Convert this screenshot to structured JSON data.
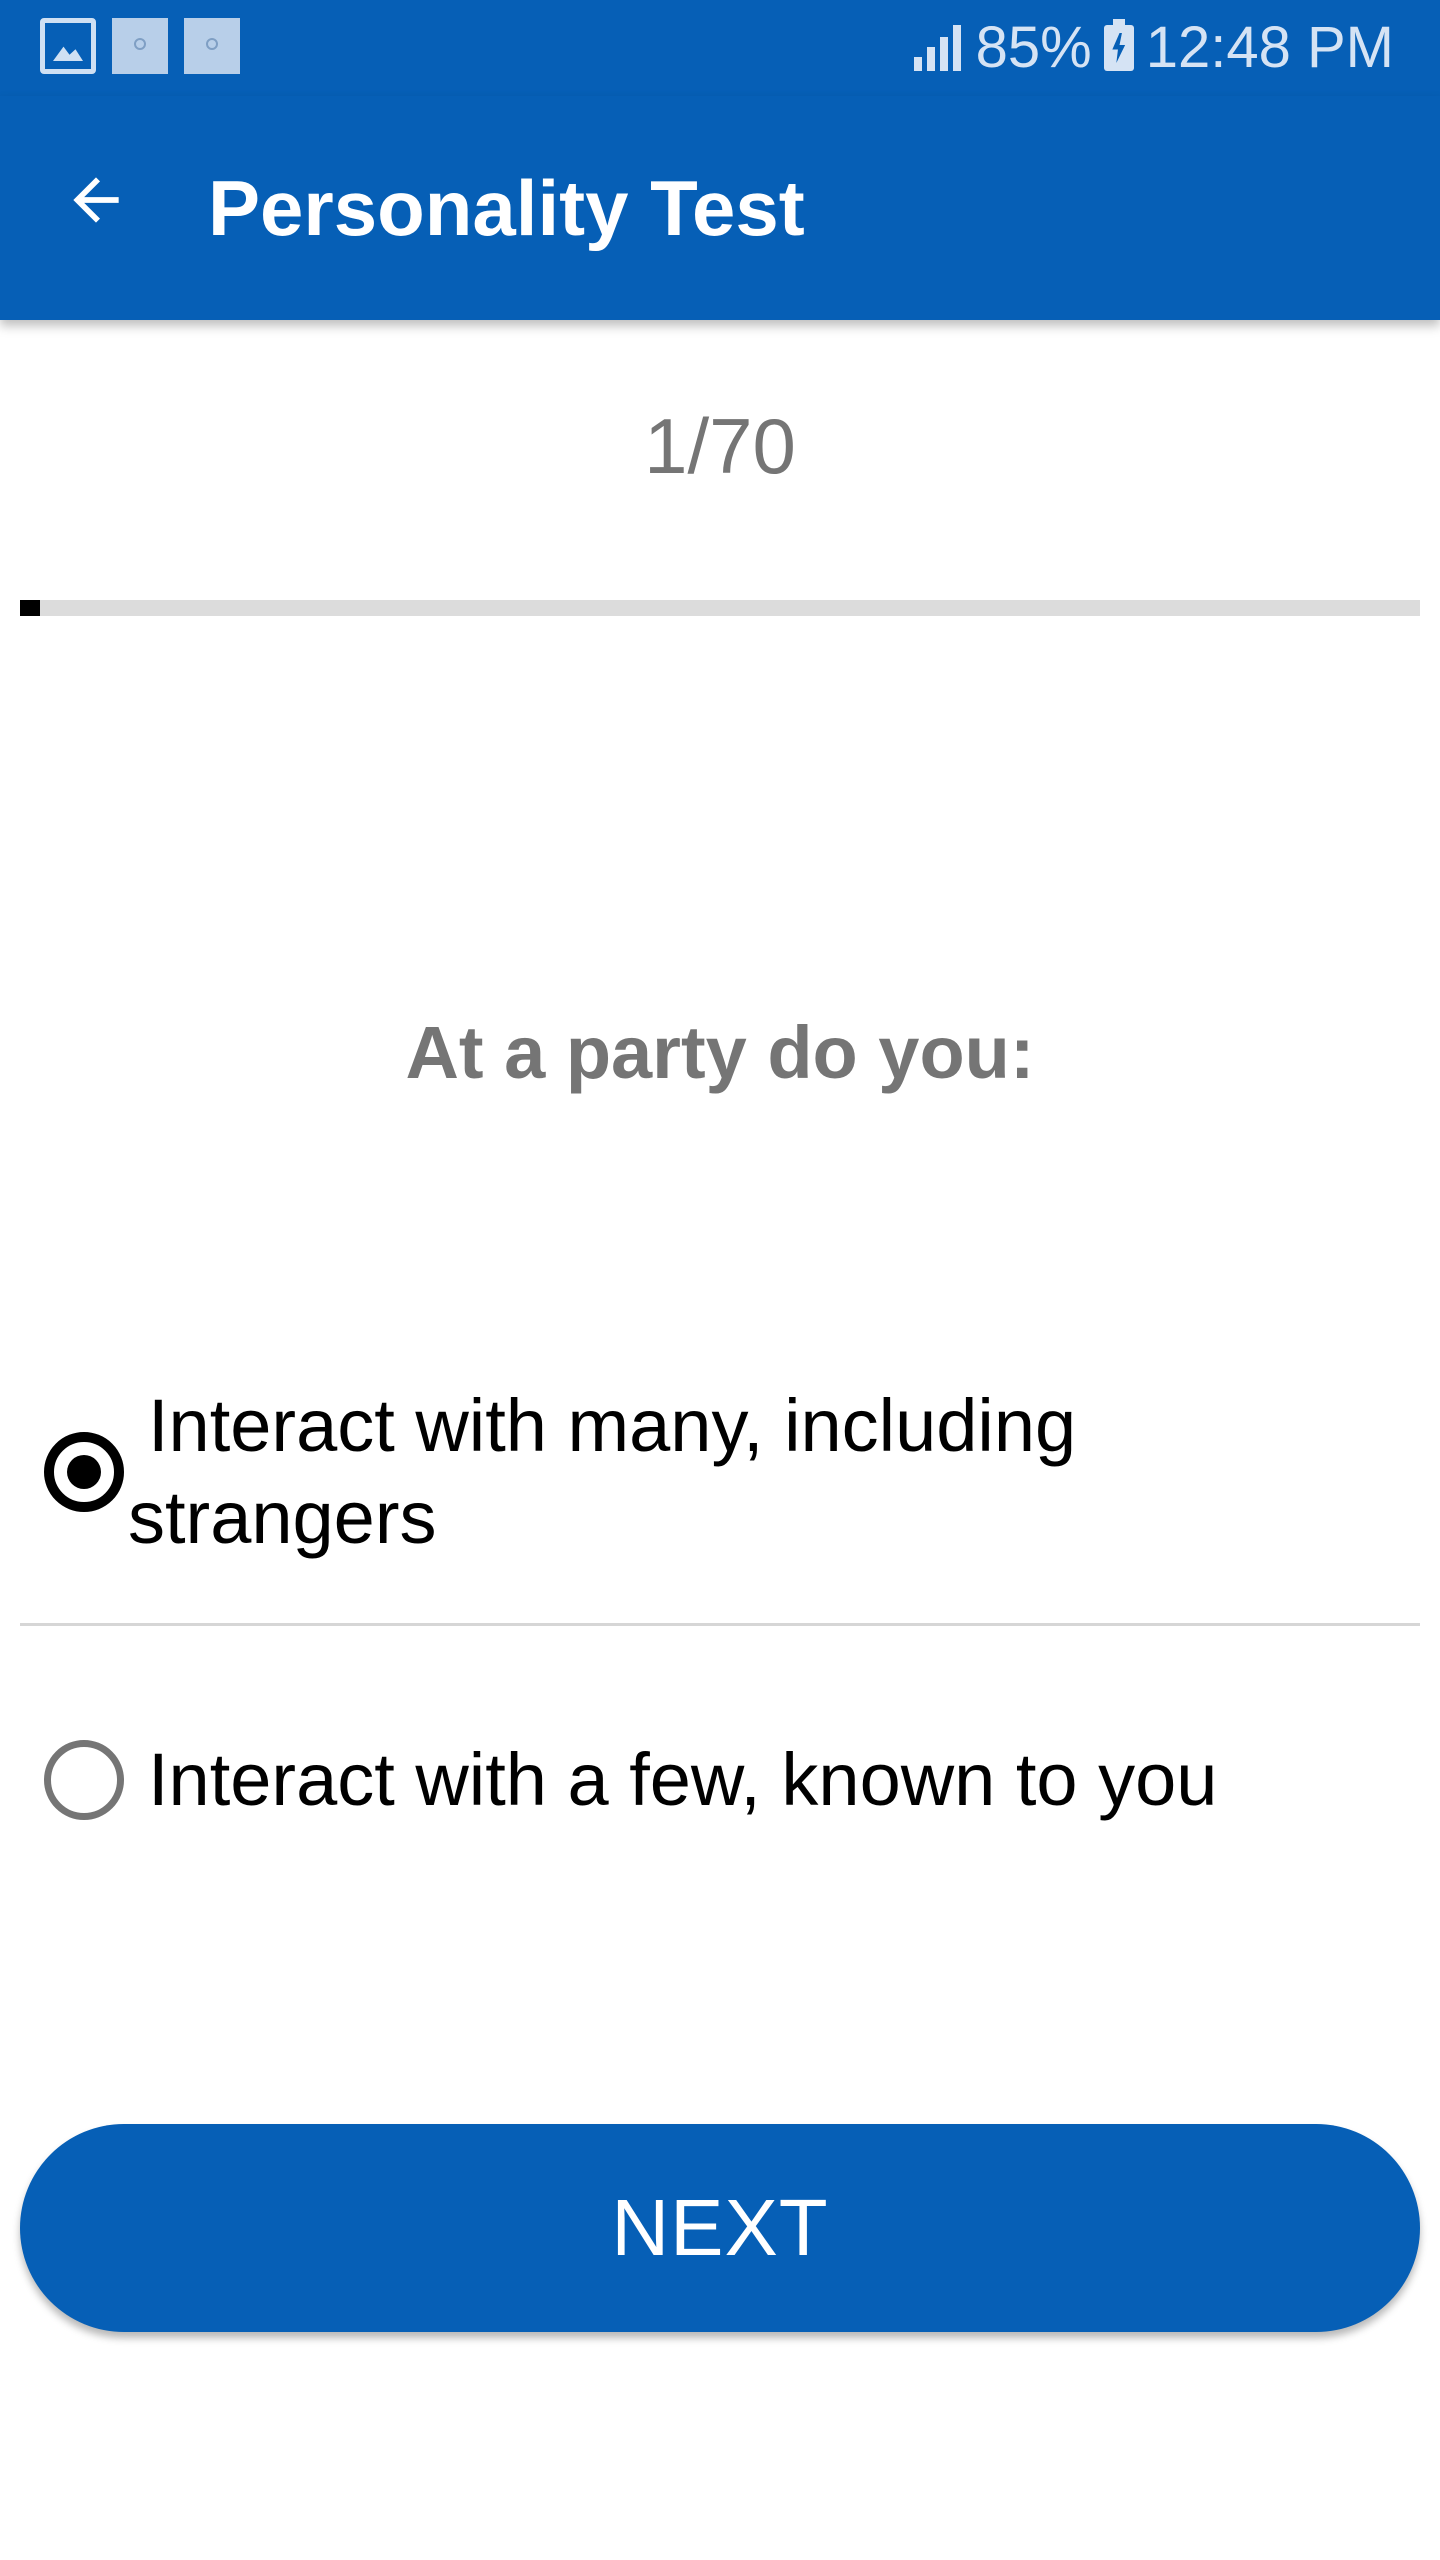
{
  "status_bar": {
    "notification_icons": [
      "gallery-icon",
      "app-notification-icon",
      "app-notification-icon"
    ],
    "signal_icon": "cellular-signal-icon",
    "battery_percent": "85%",
    "battery_icon": "battery-charging-icon",
    "time": "12:48 PM"
  },
  "app_bar": {
    "back_icon": "arrow-left-icon",
    "title": "Personality Test"
  },
  "progress": {
    "counter": "1/70",
    "current": 1,
    "total": 70,
    "fraction": 0.0143
  },
  "question": {
    "text": "At a party do you:"
  },
  "options": [
    {
      "label": "Interact with many, including strangers",
      "selected": true
    },
    {
      "label": "Interact with a few, known to you",
      "selected": false
    }
  ],
  "actions": {
    "next_label": "NEXT"
  },
  "colors": {
    "primary": "#065fb6",
    "muted_text": "#757575",
    "progress_track": "#dcdcdc",
    "progress_fill": "#000000"
  }
}
